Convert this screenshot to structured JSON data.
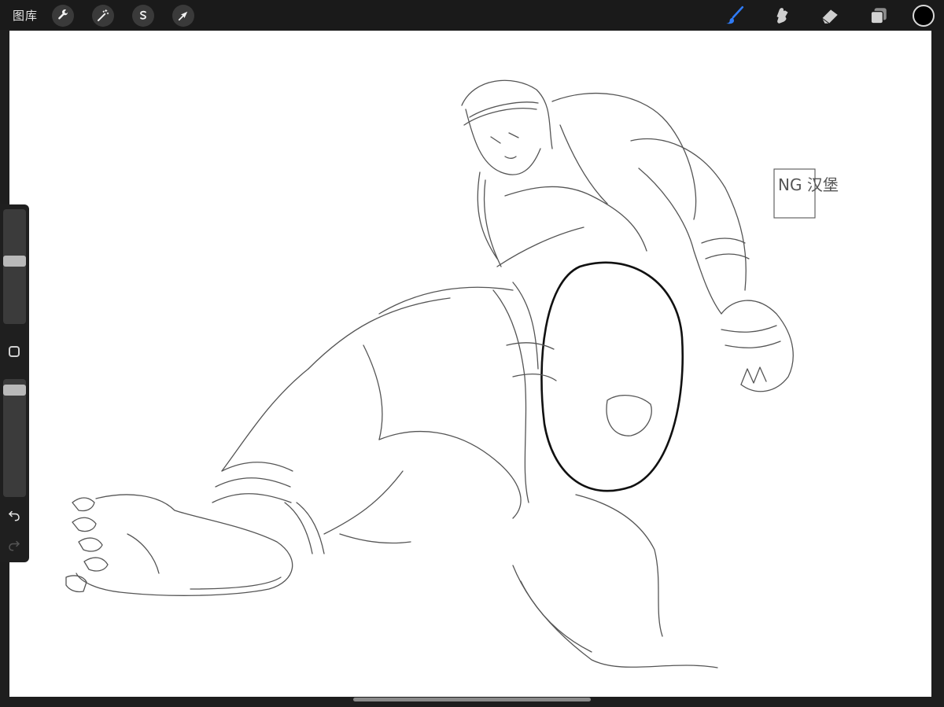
{
  "topbar": {
    "gallery_label": "图库",
    "left_tools": [
      {
        "name": "actions",
        "icon": "wrench-icon"
      },
      {
        "name": "adjustments",
        "icon": "magic-wand-icon"
      },
      {
        "name": "selection",
        "icon": "selection-s-icon"
      },
      {
        "name": "transform",
        "icon": "arrow-cursor-icon"
      }
    ],
    "right_tools": [
      {
        "name": "brush",
        "icon": "brush-icon",
        "active": true
      },
      {
        "name": "smudge",
        "icon": "smudge-icon",
        "active": false
      },
      {
        "name": "eraser",
        "icon": "eraser-icon",
        "active": false
      },
      {
        "name": "layers",
        "icon": "layers-icon",
        "active": false
      }
    ],
    "current_color": "#000000",
    "active_color": "#2f7bf5"
  },
  "sidebar": {
    "brush_size_level": 0.55,
    "opacity_level": 0.05,
    "buttons": [
      "modify-button",
      "undo-button",
      "redo-button"
    ]
  },
  "canvas": {
    "background": "#ffffff",
    "signature_text": "NG 汉堡"
  }
}
